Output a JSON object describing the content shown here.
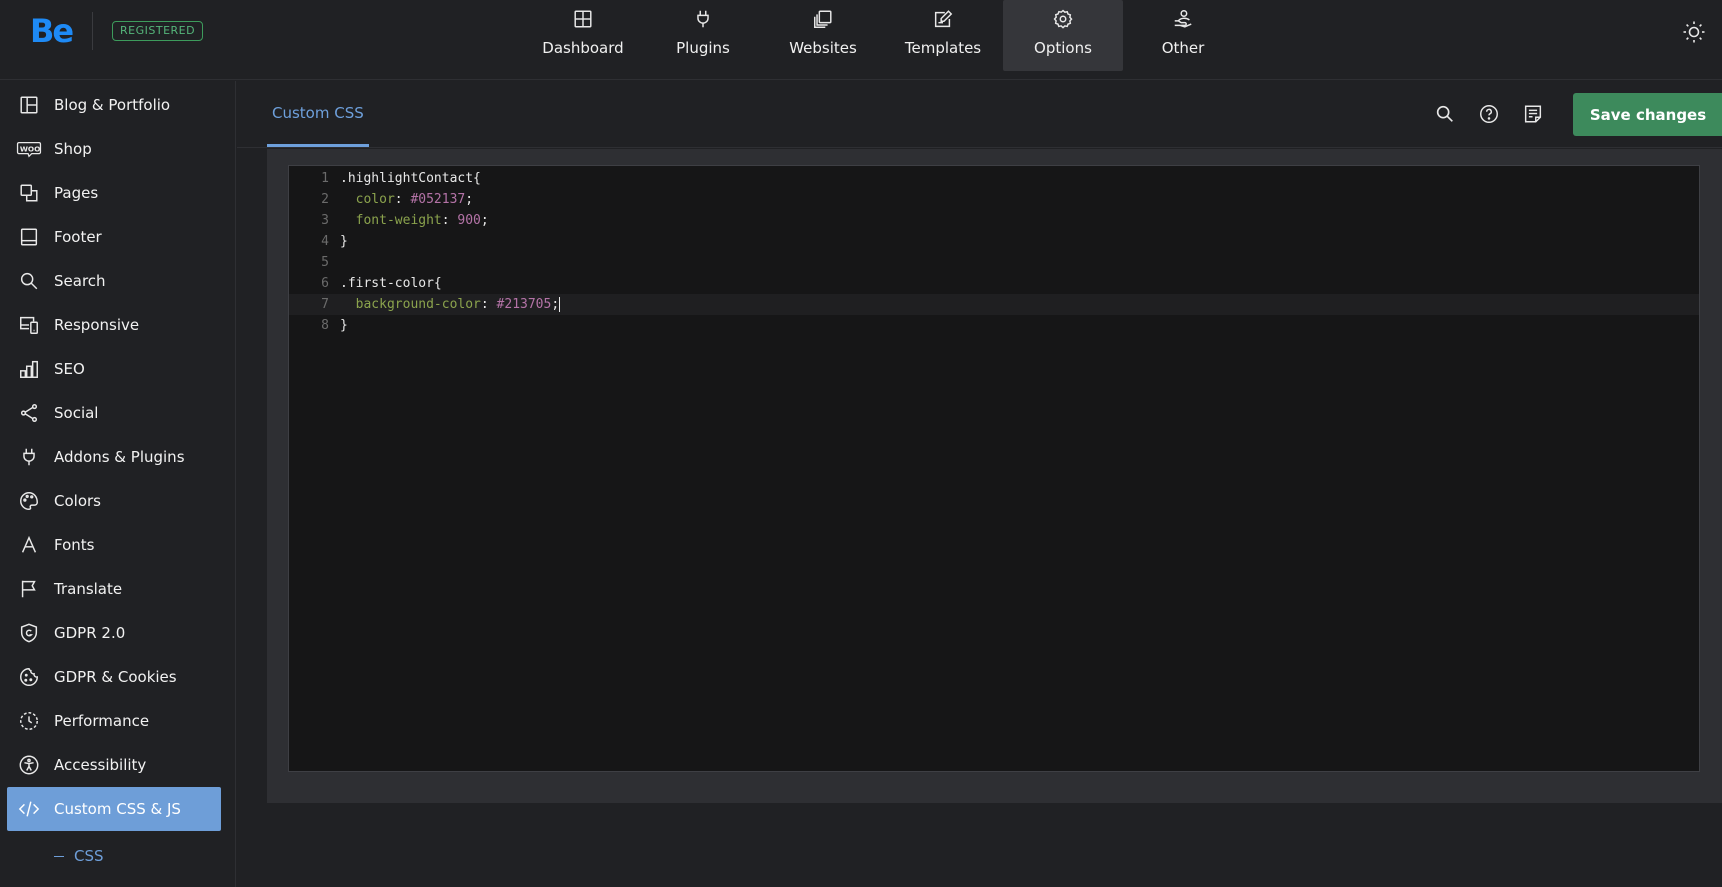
{
  "brand": {
    "logo": "Be",
    "badge": "REGISTERED"
  },
  "topnav": [
    {
      "label": "Dashboard",
      "icon": "dashboard-icon"
    },
    {
      "label": "Plugins",
      "icon": "plug-icon"
    },
    {
      "label": "Websites",
      "icon": "websites-icon"
    },
    {
      "label": "Templates",
      "icon": "templates-icon"
    },
    {
      "label": "Options",
      "icon": "gear-icon",
      "active": true
    },
    {
      "label": "Other",
      "icon": "hand-user-icon"
    }
  ],
  "sidebar": {
    "items": [
      {
        "label": "Blog & Portfolio",
        "icon": "layout-icon"
      },
      {
        "label": "Shop",
        "icon": "woo-icon"
      },
      {
        "label": "Pages",
        "icon": "pages-icon"
      },
      {
        "label": "Footer",
        "icon": "footer-icon"
      },
      {
        "label": "Search",
        "icon": "search-icon"
      },
      {
        "label": "Responsive",
        "icon": "responsive-icon"
      },
      {
        "label": "SEO",
        "icon": "bars-icon"
      },
      {
        "label": "Social",
        "icon": "share-icon"
      },
      {
        "label": "Addons & Plugins",
        "icon": "plug-icon"
      },
      {
        "label": "Colors",
        "icon": "palette-icon"
      },
      {
        "label": "Fonts",
        "icon": "font-icon"
      },
      {
        "label": "Translate",
        "icon": "flag-icon"
      },
      {
        "label": "GDPR 2.0",
        "icon": "shield-icon"
      },
      {
        "label": "GDPR & Cookies",
        "icon": "cookie-icon"
      },
      {
        "label": "Performance",
        "icon": "performance-icon"
      },
      {
        "label": "Accessibility",
        "icon": "accessibility-icon"
      },
      {
        "label": "Custom CSS & JS",
        "icon": "code-icon",
        "active": true
      }
    ],
    "subitems": [
      {
        "label": "CSS",
        "active": true
      }
    ]
  },
  "main": {
    "tab": "Custom CSS",
    "tools": [
      "search-icon",
      "help-icon",
      "notes-icon"
    ],
    "save_label": "Save changes"
  },
  "editor": {
    "lines": [
      {
        "n": "1",
        "tokens": [
          [
            ".highlightContact{",
            "sel"
          ]
        ]
      },
      {
        "n": "2",
        "tokens": [
          [
            "  ",
            "punct"
          ],
          [
            "color",
            "prop"
          ],
          [
            ": ",
            "punct"
          ],
          [
            "#052137",
            "val"
          ],
          [
            ";",
            "punct"
          ]
        ]
      },
      {
        "n": "3",
        "tokens": [
          [
            "  ",
            "punct"
          ],
          [
            "font-weight",
            "prop"
          ],
          [
            ": ",
            "punct"
          ],
          [
            "900",
            "val"
          ],
          [
            ";",
            "punct"
          ]
        ]
      },
      {
        "n": "4",
        "tokens": [
          [
            "}",
            "punct"
          ]
        ]
      },
      {
        "n": "5",
        "tokens": []
      },
      {
        "n": "6",
        "tokens": [
          [
            ".first-color{",
            "sel"
          ]
        ]
      },
      {
        "n": "7",
        "tokens": [
          [
            "  ",
            "punct"
          ],
          [
            "background-color",
            "prop"
          ],
          [
            ": ",
            "punct"
          ],
          [
            "#213705",
            "val"
          ],
          [
            ";",
            "punct"
          ]
        ],
        "current": true
      },
      {
        "n": "8",
        "tokens": [
          [
            "}",
            "punct"
          ]
        ]
      }
    ]
  },
  "colors": {
    "accent": "#6e9ed8",
    "save": "#3d8a5c",
    "brand": "#1e8af5"
  }
}
